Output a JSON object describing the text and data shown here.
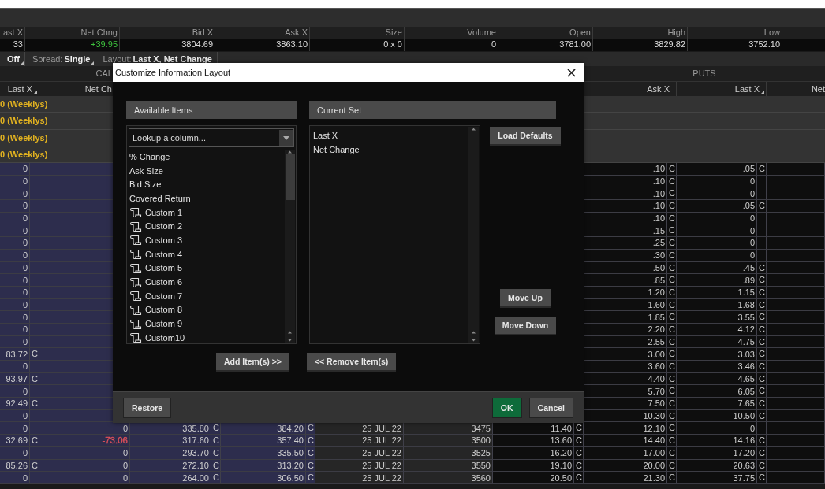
{
  "quote": {
    "columns": [
      "ast X",
      "Net Chng",
      "Bid X",
      "Ask X",
      "Size",
      "Volume",
      "Open",
      "High",
      "Low"
    ],
    "values": [
      {
        "text": "33"
      },
      {
        "text": "+39.95",
        "color": "#3ec23e"
      },
      {
        "text": "3804.69"
      },
      {
        "text": "3863.10"
      },
      {
        "text": "0 x 0"
      },
      {
        "text": "0"
      },
      {
        "text": "3781.00"
      },
      {
        "text": "3829.82"
      },
      {
        "text": "3752.10"
      }
    ]
  },
  "toolbar": [
    {
      "value": "Off",
      "caret": true
    },
    {
      "label": "Spread:",
      "value": "Single",
      "caret": true
    },
    {
      "label": "Layout:",
      "value": "Last X, Net Change",
      "caret": false
    }
  ],
  "sides": {
    "calls": "CAL",
    "puts": "PUTS"
  },
  "table": {
    "columns": [
      {
        "label": "Last X",
        "sort_handle": true
      },
      {
        "label": "Net Ch",
        "sort_handle": false
      },
      {},
      {},
      {},
      {},
      {},
      {
        "label": "Ask X",
        "sort_handle": false
      },
      {
        "label": "Last X",
        "sort_handle": true
      },
      {
        "label": "Net"
      }
    ],
    "rows": [
      {
        "kind": "series",
        "label": "0 (Weeklys)"
      },
      {
        "kind": "series",
        "label": "0 (Weeklys)"
      },
      {
        "kind": "series",
        "label": "0 (Weeklys)"
      },
      {
        "kind": "series",
        "label": "0 (Weeklys)"
      },
      {
        "kind": "option",
        "cells": [
          {
            "v": "0"
          },
          null,
          null,
          null,
          null,
          null,
          null,
          {
            "v": ".10",
            "m": "C"
          },
          {
            "v": ".05",
            "m": "C"
          },
          null
        ]
      },
      {
        "kind": "option",
        "cells": [
          {
            "v": "0"
          },
          null,
          null,
          null,
          null,
          null,
          null,
          {
            "v": ".10",
            "m": "C"
          },
          {
            "v": "0"
          },
          null
        ]
      },
      {
        "kind": "option",
        "cells": [
          {
            "v": "0"
          },
          null,
          null,
          null,
          null,
          null,
          null,
          {
            "v": ".10",
            "m": "C"
          },
          {
            "v": "0"
          },
          null
        ]
      },
      {
        "kind": "option",
        "cells": [
          {
            "v": "0"
          },
          null,
          null,
          null,
          null,
          null,
          null,
          {
            "v": ".10",
            "m": "C"
          },
          {
            "v": ".05",
            "m": "C"
          },
          null
        ]
      },
      {
        "kind": "option",
        "cells": [
          {
            "v": "0"
          },
          null,
          null,
          null,
          null,
          null,
          null,
          {
            "v": ".10",
            "m": "C"
          },
          {
            "v": "0"
          },
          null
        ]
      },
      {
        "kind": "option",
        "cells": [
          {
            "v": "0"
          },
          null,
          null,
          null,
          null,
          null,
          null,
          {
            "v": ".15",
            "m": "C"
          },
          {
            "v": "0"
          },
          null
        ]
      },
      {
        "kind": "option",
        "cells": [
          {
            "v": "0"
          },
          null,
          null,
          null,
          null,
          null,
          null,
          {
            "v": ".25",
            "m": "C"
          },
          {
            "v": "0"
          },
          null
        ]
      },
      {
        "kind": "option",
        "cells": [
          {
            "v": "0"
          },
          null,
          null,
          null,
          null,
          null,
          null,
          {
            "v": ".30",
            "m": "C"
          },
          {
            "v": "0"
          },
          null
        ]
      },
      {
        "kind": "option",
        "cells": [
          {
            "v": "0"
          },
          null,
          null,
          null,
          null,
          null,
          null,
          {
            "v": ".50",
            "m": "C"
          },
          {
            "v": ".45",
            "m": "C"
          },
          null
        ]
      },
      {
        "kind": "option",
        "cells": [
          {
            "v": "0"
          },
          null,
          null,
          null,
          null,
          null,
          null,
          {
            "v": ".85",
            "m": "C"
          },
          {
            "v": ".89",
            "m": "C"
          },
          null
        ]
      },
      {
        "kind": "option",
        "cells": [
          {
            "v": "0"
          },
          null,
          null,
          null,
          null,
          null,
          null,
          {
            "v": "1.20",
            "m": "C"
          },
          {
            "v": "1.15",
            "m": "C"
          },
          null
        ]
      },
      {
        "kind": "option",
        "cells": [
          {
            "v": "0"
          },
          null,
          null,
          null,
          null,
          null,
          null,
          {
            "v": "1.60",
            "m": "C"
          },
          {
            "v": "1.68",
            "m": "C"
          },
          null
        ]
      },
      {
        "kind": "option",
        "cells": [
          {
            "v": "0"
          },
          null,
          null,
          null,
          null,
          null,
          null,
          {
            "v": "1.85",
            "m": "C"
          },
          {
            "v": "3.55",
            "m": "C"
          },
          null
        ]
      },
      {
        "kind": "option",
        "cells": [
          {
            "v": "0"
          },
          null,
          null,
          null,
          null,
          null,
          null,
          {
            "v": "2.20",
            "m": "C"
          },
          {
            "v": "4.12",
            "m": "C"
          },
          null
        ]
      },
      {
        "kind": "option",
        "cells": [
          {
            "v": "0"
          },
          null,
          null,
          null,
          null,
          null,
          null,
          {
            "v": "2.55",
            "m": "C"
          },
          {
            "v": "4.75",
            "m": "C"
          },
          null
        ]
      },
      {
        "kind": "option",
        "cells": [
          {
            "v": "83.72",
            "m": "C"
          },
          null,
          null,
          null,
          null,
          null,
          null,
          {
            "v": "3.00",
            "m": "C"
          },
          {
            "v": "3.03",
            "m": "C"
          },
          null
        ]
      },
      {
        "kind": "option",
        "cells": [
          {
            "v": "0"
          },
          null,
          null,
          null,
          null,
          null,
          null,
          {
            "v": "3.60",
            "m": "C"
          },
          {
            "v": "3.46",
            "m": "C"
          },
          null
        ]
      },
      {
        "kind": "option",
        "cells": [
          {
            "v": "93.97",
            "m": "C"
          },
          null,
          null,
          null,
          null,
          null,
          null,
          {
            "v": "4.40",
            "m": "C"
          },
          {
            "v": "4.65",
            "m": "C"
          },
          null
        ]
      },
      {
        "kind": "option",
        "cells": [
          {
            "v": "0"
          },
          null,
          null,
          null,
          null,
          null,
          null,
          {
            "v": "5.70",
            "m": "C"
          },
          {
            "v": "6.05",
            "m": "C"
          },
          null
        ]
      },
      {
        "kind": "option",
        "cells": [
          {
            "v": "92.49",
            "m": "C"
          },
          null,
          null,
          null,
          null,
          null,
          null,
          {
            "v": "7.50",
            "m": "C"
          },
          {
            "v": "7.65",
            "m": "C"
          },
          null
        ]
      },
      {
        "kind": "option",
        "cells": [
          {
            "v": "0"
          },
          null,
          null,
          null,
          null,
          null,
          null,
          {
            "v": "10.30",
            "m": "C"
          },
          {
            "v": "10.50",
            "m": "C"
          },
          null
        ]
      },
      {
        "kind": "option",
        "cells": [
          {
            "v": "0"
          },
          {
            "v": "0"
          },
          {
            "v": "335.80",
            "m": "C"
          },
          {
            "v": "384.20",
            "m": "C"
          },
          {
            "v": "25 JUL 22"
          },
          {
            "v": "3475"
          },
          {
            "v": "11.40",
            "m": "C"
          },
          {
            "v": "12.10",
            "m": "C"
          },
          {
            "v": "0"
          },
          null
        ]
      },
      {
        "kind": "option",
        "cells": [
          {
            "v": "32.69",
            "m": "C"
          },
          {
            "v": "-73.06",
            "color": "#e0505a"
          },
          {
            "v": "317.60",
            "m": "C"
          },
          {
            "v": "357.40",
            "m": "C"
          },
          {
            "v": "25 JUL 22"
          },
          {
            "v": "3500"
          },
          {
            "v": "13.60",
            "m": "C"
          },
          {
            "v": "14.40",
            "m": "C"
          },
          {
            "v": "14.16",
            "m": "C"
          },
          null
        ]
      },
      {
        "kind": "option",
        "cells": [
          {
            "v": "0"
          },
          {
            "v": "0"
          },
          {
            "v": "293.70",
            "m": "C"
          },
          {
            "v": "335.50",
            "m": "C"
          },
          {
            "v": "25 JUL 22"
          },
          {
            "v": "3525"
          },
          {
            "v": "16.20",
            "m": "C"
          },
          {
            "v": "17.00",
            "m": "C"
          },
          {
            "v": "17.20",
            "m": "C"
          },
          null
        ]
      },
      {
        "kind": "option",
        "cells": [
          {
            "v": "85.26",
            "m": "C"
          },
          {
            "v": "0"
          },
          {
            "v": "272.10",
            "m": "C"
          },
          {
            "v": "313.20",
            "m": "C"
          },
          {
            "v": "25 JUL 22"
          },
          {
            "v": "3550"
          },
          {
            "v": "19.10",
            "m": "C"
          },
          {
            "v": "20.00",
            "m": "C"
          },
          {
            "v": "20.63",
            "m": "C"
          },
          null
        ]
      },
      {
        "kind": "option",
        "cells": [
          {
            "v": "0"
          },
          {
            "v": "0"
          },
          {
            "v": "264.00",
            "m": "C"
          },
          {
            "v": "306.50",
            "m": "C"
          },
          {
            "v": "25 JUL 22"
          },
          {
            "v": "3560"
          },
          {
            "v": "20.50",
            "m": "C"
          },
          {
            "v": "21.30",
            "m": "C"
          },
          {
            "v": "37.75",
            "m": "C"
          },
          null
        ]
      }
    ]
  },
  "dialog": {
    "title": "Customize Information Layout",
    "close": "×",
    "available": {
      "header": "Available Items",
      "lookup_placeholder": "Lookup a column...",
      "items": [
        {
          "label": "% Change",
          "custom": false
        },
        {
          "label": "Ask Size",
          "custom": false
        },
        {
          "label": "Bid Size",
          "custom": false
        },
        {
          "label": "Covered Return",
          "custom": false
        },
        {
          "label": "Custom 1",
          "custom": true
        },
        {
          "label": "Custom 2",
          "custom": true
        },
        {
          "label": "Custom 3",
          "custom": true
        },
        {
          "label": "Custom 4",
          "custom": true
        },
        {
          "label": "Custom 5",
          "custom": true
        },
        {
          "label": "Custom 6",
          "custom": true
        },
        {
          "label": "Custom 7",
          "custom": true
        },
        {
          "label": "Custom 8",
          "custom": true
        },
        {
          "label": "Custom 9",
          "custom": true
        },
        {
          "label": "Custom10",
          "custom": true
        }
      ]
    },
    "current": {
      "header": "Current Set",
      "items": [
        "Last X",
        "Net Change"
      ]
    },
    "side_buttons": {
      "load_defaults": "Load Defaults",
      "move_up": "Move Up",
      "move_down": "Move Down"
    },
    "add": "Add Item(s) >>",
    "remove": "<< Remove Item(s)",
    "footer": {
      "restore": "Restore",
      "ok": "OK",
      "cancel": "Cancel"
    }
  }
}
